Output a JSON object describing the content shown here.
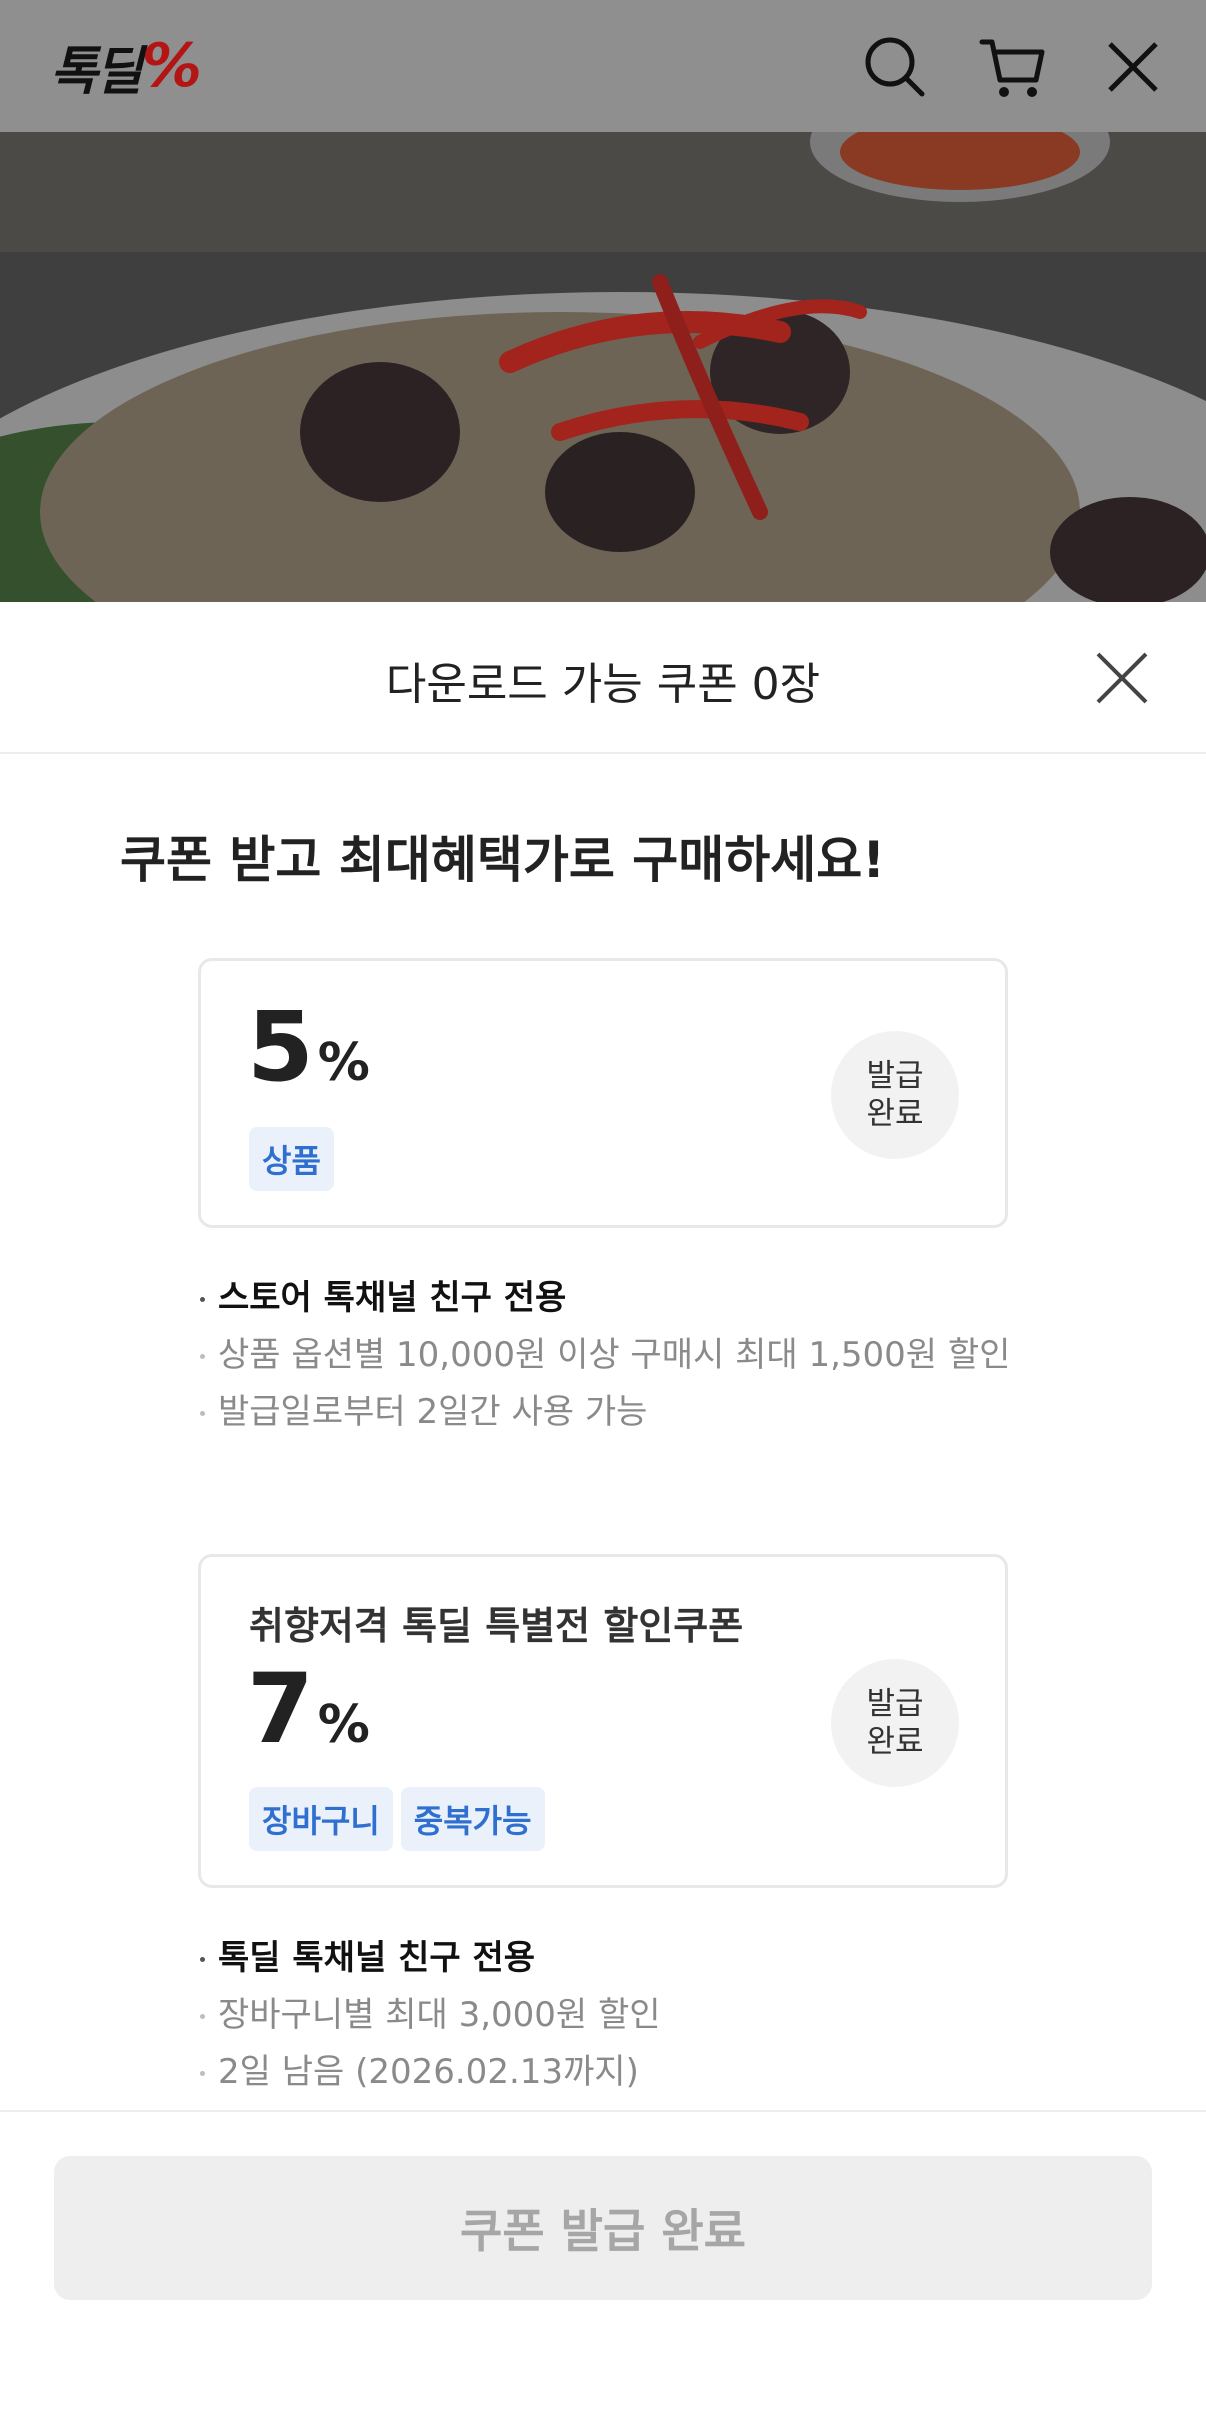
{
  "header": {
    "logo_text": "톡딜",
    "logo_mark": "%",
    "icons": [
      "search-icon",
      "cart-icon",
      "close-icon"
    ]
  },
  "sheet": {
    "title": "다운로드 가능 쿠폰 0장",
    "headline": "쿠폰 받고 최대혜택가로 구매하세요!",
    "coupons": [
      {
        "name": "",
        "rate": "5",
        "unit": "%",
        "tags": [
          "상품"
        ],
        "status_line1": "발급",
        "status_line2": "완료",
        "notes": [
          "스토어 톡채널 친구 전용",
          "상품 옵션별 10,000원 이상 구매시 최대 1,500원 할인",
          "발급일로부터 2일간 사용 가능"
        ]
      },
      {
        "name": "취향저격 톡딜 특별전 할인쿠폰",
        "rate": "7",
        "unit": "%",
        "tags": [
          "장바구니",
          "중복가능"
        ],
        "status_line1": "발급",
        "status_line2": "완료",
        "notes": [
          "톡딜 톡채널 친구 전용",
          "장바구니별 최대 3,000원 할인",
          "2일 남음 (2026.02.13까지)"
        ]
      }
    ],
    "cta_label": "쿠폰 발급 완료"
  },
  "colors": {
    "header_dim": "#8f8f8f",
    "tag_text": "#2f6fd0",
    "tag_bg": "#eaf1fb",
    "logo_accent": "#b31414",
    "cta_bg": "#eeeeee"
  }
}
